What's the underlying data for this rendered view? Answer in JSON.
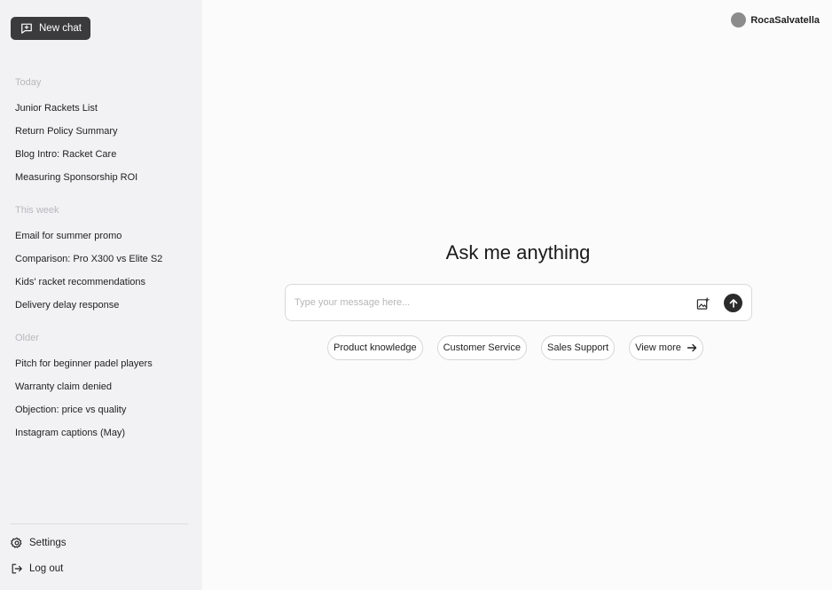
{
  "sidebar": {
    "new_chat_label": "New chat",
    "groups": [
      {
        "label": "Today",
        "items": [
          "Junior Rackets List",
          "Return Policy Summary",
          "Blog Intro: Racket Care",
          "Measuring Sponsorship ROI"
        ]
      },
      {
        "label": "This week",
        "items": [
          "Email for summer promo",
          "Comparison: Pro X300 vs Elite S2",
          "Kids' racket recommendations",
          "Delivery delay response"
        ]
      },
      {
        "label": "Older",
        "items": [
          "Pitch for beginner padel players",
          "Warranty claim denied",
          "Objection: price vs quality",
          "Instagram captions (May)"
        ]
      }
    ],
    "settings_label": "Settings",
    "logout_label": "Log out"
  },
  "header": {
    "username": "RocaSalvatella"
  },
  "main": {
    "headline": "Ask me anything",
    "input_placeholder": "Type your message here...",
    "input_value": "",
    "chips": [
      "Product knowledge",
      "Customer Service",
      "Sales Support",
      "View more"
    ]
  },
  "icons": {
    "new_chat": "chat-plus-icon",
    "settings": "gear-icon",
    "logout": "logout-icon",
    "image": "image-upload-icon",
    "send": "arrow-up-icon",
    "view_more": "arrow-right-icon"
  },
  "colors": {
    "sidebar_bg": "#f2f2f4",
    "main_bg": "#fbfbfc",
    "button_dark": "#3b3b3d",
    "muted_label": "#b9b9bd"
  }
}
